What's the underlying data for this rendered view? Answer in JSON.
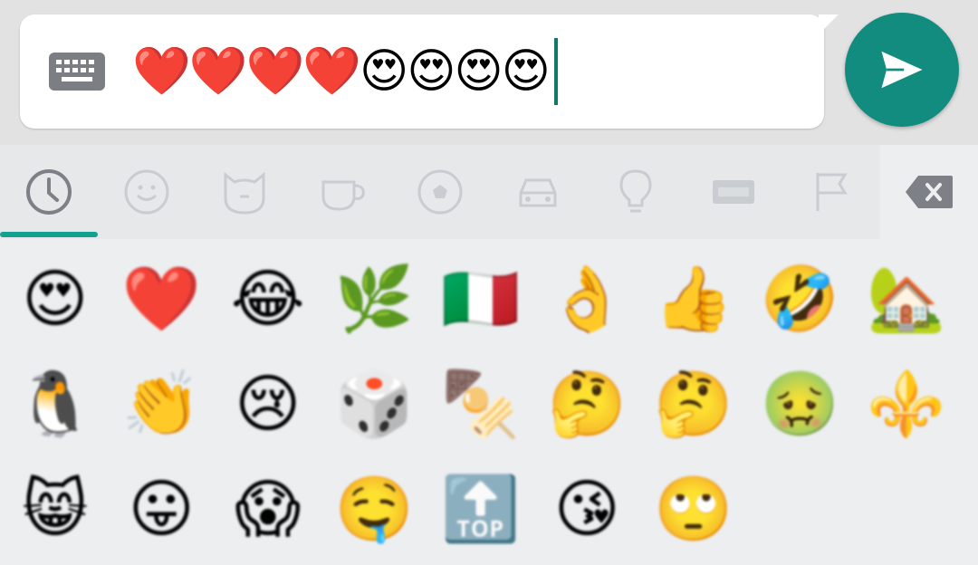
{
  "compose": {
    "typed_text": "❤️❤️❤️❤️😍😍😍😍",
    "accent_color": "#128c7e",
    "keyboard_toggle_icon": "keyboard-icon",
    "send_icon": "send-icon"
  },
  "tabs": [
    {
      "name": "recent",
      "icon": "clock-icon",
      "selected": true
    },
    {
      "name": "smileys",
      "icon": "smiley-icon"
    },
    {
      "name": "animals",
      "icon": "cat-face-icon"
    },
    {
      "name": "food",
      "icon": "coffee-cup-icon"
    },
    {
      "name": "activity",
      "icon": "soccer-ball-icon"
    },
    {
      "name": "travel",
      "icon": "car-icon"
    },
    {
      "name": "objects",
      "icon": "lightbulb-icon"
    },
    {
      "name": "symbols",
      "icon": "symbols-icon"
    },
    {
      "name": "flags",
      "icon": "flag-icon"
    }
  ],
  "backspace_icon": "backspace-icon",
  "emoji_grid": [
    "😍",
    "❤️",
    "😂",
    "🌿",
    "🇮🇹",
    "👌",
    "👍",
    "🤣",
    "🏡",
    "🐧",
    "👏",
    "😢",
    "🎲",
    "🍢",
    "🤔",
    "🤔",
    "🤢",
    "⚜️",
    "😸",
    "😛",
    "😱",
    "🤤",
    "🔝",
    "😘",
    "🙄"
  ]
}
